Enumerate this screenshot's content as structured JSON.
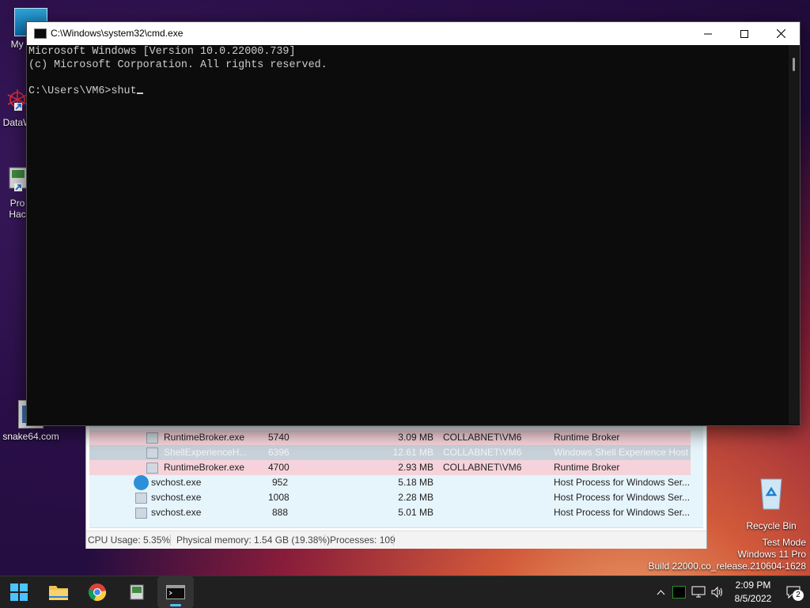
{
  "desktop": {
    "icons": [
      {
        "label": "My Co"
      },
      {
        "label": "DataW"
      },
      {
        "label": "Pro",
        "label2": "Hac"
      },
      {
        "label": "snake64.com"
      },
      {
        "label": "Recycle Bin"
      }
    ],
    "watermark": {
      "line1": "Test Mode",
      "line2": "Windows 11 Pro",
      "line3": "Build 22000.co_release.210604-1628"
    }
  },
  "cmd_window": {
    "title": "C:\\Windows\\system32\\cmd.exe",
    "lines": [
      "Microsoft Windows [Version 10.0.22000.739]",
      "(c) Microsoft Corporation. All rights reserved.",
      "",
      "C:\\Users\\VM6>shut"
    ]
  },
  "task_manager": {
    "rows": [
      {
        "name": "RuntimeBroker.exe",
        "pid": "5740",
        "memory": "3.09 MB",
        "user": "COLLABNET\\VM6",
        "description": "Runtime Broker"
      },
      {
        "name": "ShellExperienceH...",
        "pid": "6396",
        "memory": "12.61 MB",
        "user": "COLLABNET\\VM6",
        "description": "Windows Shell Experience Host"
      },
      {
        "name": "RuntimeBroker.exe",
        "pid": "4700",
        "memory": "2.93 MB",
        "user": "COLLABNET\\VM6",
        "description": "Runtime Broker"
      },
      {
        "name": "svchost.exe",
        "pid": "952",
        "memory": "5.18 MB",
        "user": "",
        "description": "Host Process for Windows Ser..."
      },
      {
        "name": "svchost.exe",
        "pid": "1008",
        "memory": "2.28 MB",
        "user": "",
        "description": "Host Process for Windows Ser..."
      },
      {
        "name": "svchost.exe",
        "pid": "888",
        "memory": "5.01 MB",
        "user": "",
        "description": "Host Process for Windows Ser..."
      }
    ],
    "status": {
      "cpu": "CPU Usage: 5.35%",
      "memory": "Physical memory: 1.54 GB (19.38%)",
      "processes": "Processes: 109"
    }
  },
  "taskbar": {
    "time": "2:09 PM",
    "date": "8/5/2022",
    "notification_count": "2"
  },
  "colors": {
    "row_pink": "#f6d3da",
    "row_gray": "#c8d2da",
    "row_blue": "#e6f4fb"
  }
}
